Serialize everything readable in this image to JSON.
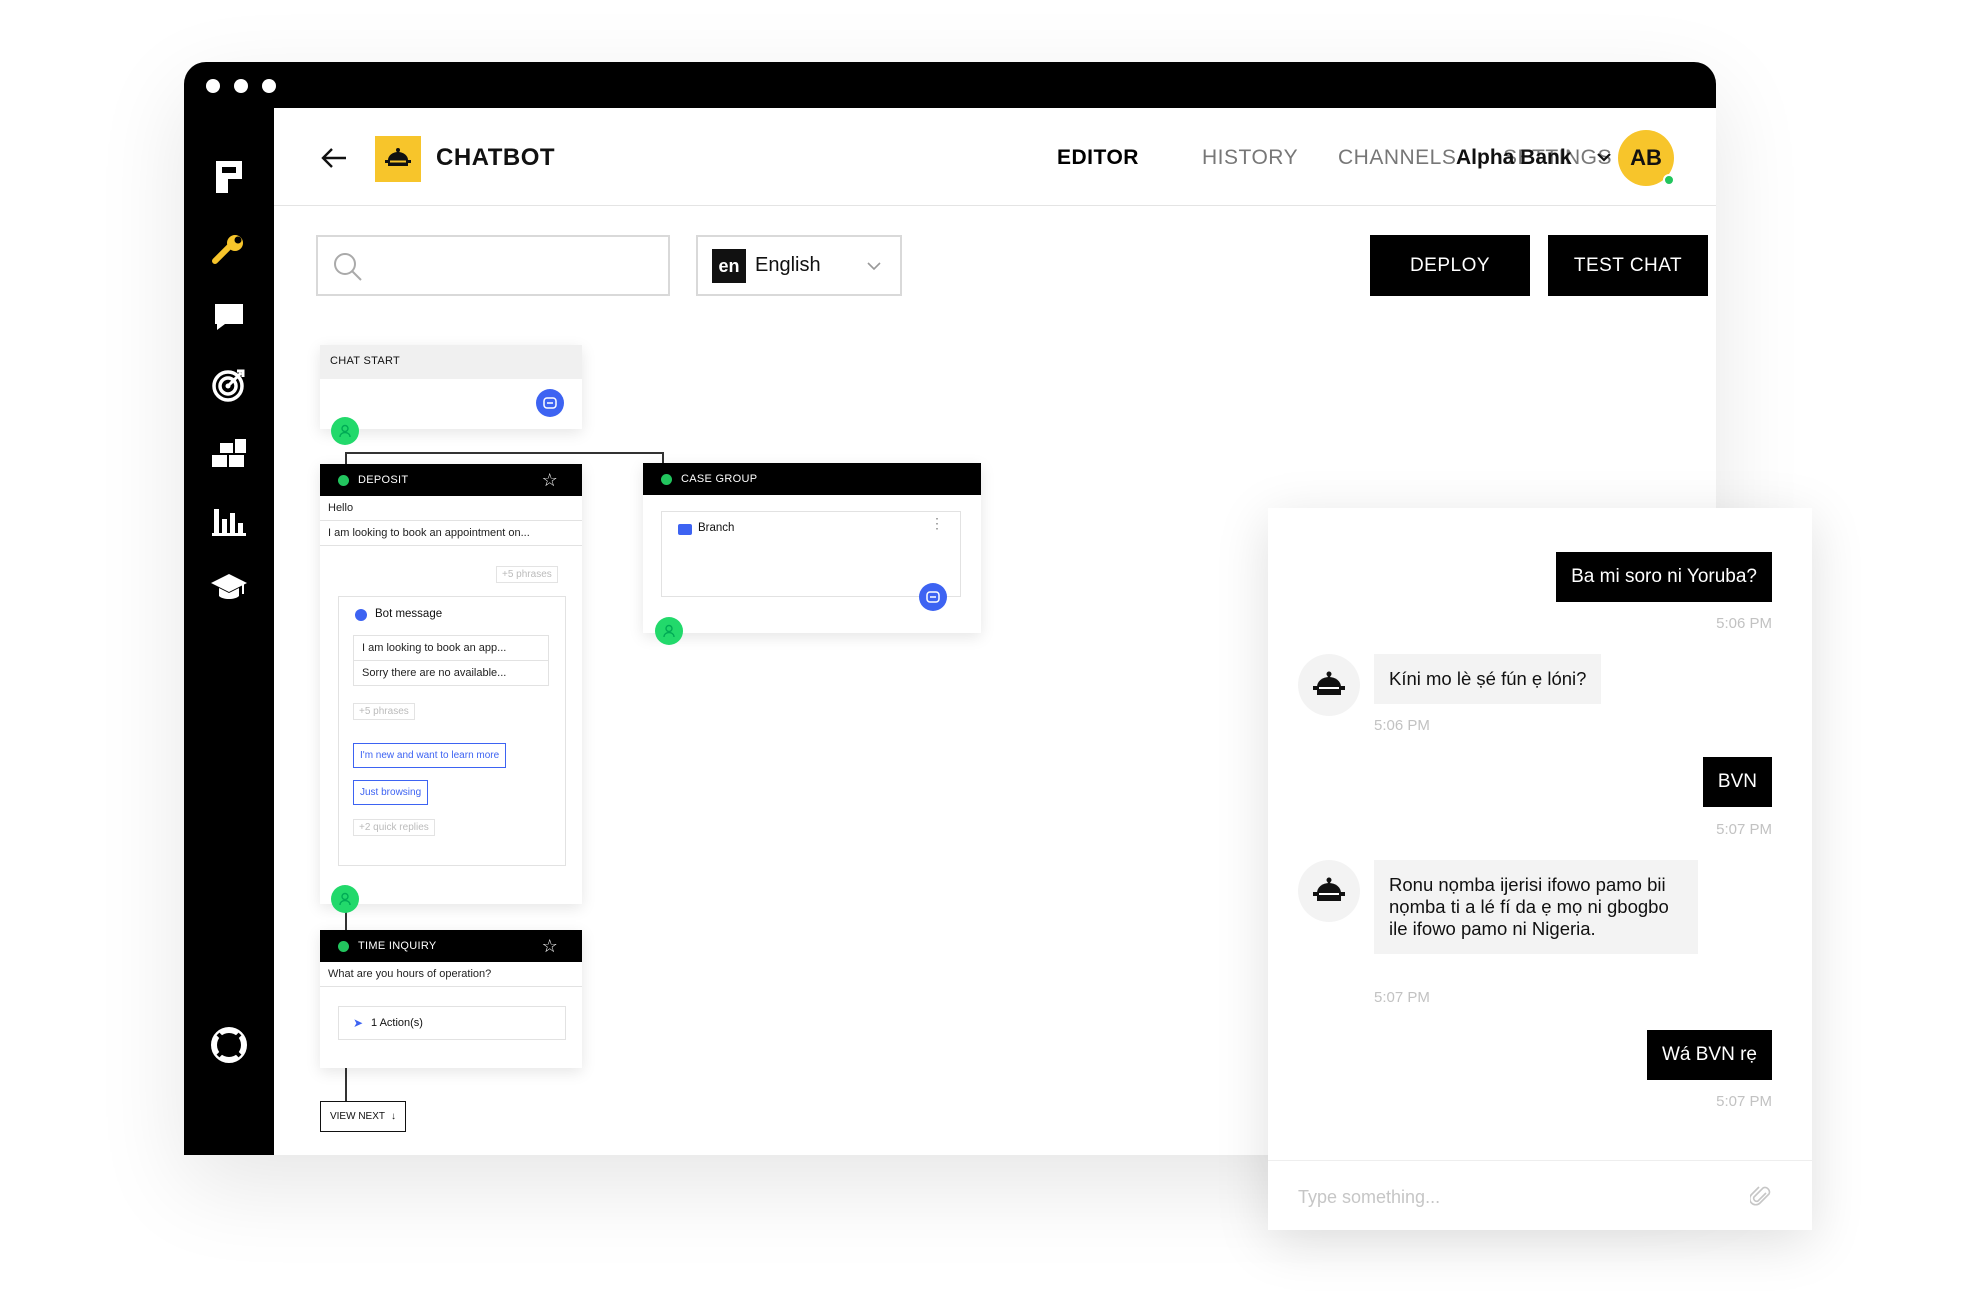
{
  "header": {
    "app_title": "CHATBOT",
    "tabs": [
      {
        "label": "EDITOR",
        "active": true
      },
      {
        "label": "HISTORY",
        "active": false
      },
      {
        "label": "CHANNELS",
        "active": false
      },
      {
        "label": "SETTINGS",
        "active": false
      }
    ],
    "organization": "Alpha Bank",
    "avatar_initials": "AB"
  },
  "toolbar": {
    "search_placeholder": "",
    "language_code": "en",
    "language_name": "English",
    "deploy_label": "DEPLOY",
    "test_chat_label": "TEST CHAT"
  },
  "sidebar": {
    "items": [
      "logo-icon",
      "wrench-icon",
      "chat-bubble-icon",
      "target-icon",
      "blocks-icon",
      "bar-chart-icon",
      "graduation-cap-icon",
      "lifebuoy-icon"
    ]
  },
  "flow": {
    "chat_start": {
      "title": "CHAT START"
    },
    "deposit": {
      "title": "DEPOSIT",
      "phrases": [
        "Hello",
        "I am looking to book an appointment on..."
      ],
      "more_phrases": "+5 phrases",
      "bot_message": {
        "title": "Bot message",
        "lines": [
          "I am looking to book an app...",
          "Sorry there are no available..."
        ],
        "more_phrases": "+5 phrases",
        "quick_replies": [
          "I'm new and want to learn more",
          "Just browsing"
        ],
        "more_quick_replies": "+2 quick replies"
      }
    },
    "case_group": {
      "title": "CASE GROUP",
      "item": "Branch"
    },
    "time_inquiry": {
      "title": "TIME INQUIRY",
      "phrase": "What are you hours of operation?",
      "actions": "1 Action(s)"
    },
    "view_next": "VIEW NEXT"
  },
  "chat": {
    "messages": [
      {
        "from": "user",
        "text": "Ba mi soro ni Yoruba?",
        "time": "5:06 PM"
      },
      {
        "from": "bot",
        "text": "Kíni mo lè ṣé fún ẹ lóni?",
        "time": "5:06 PM"
      },
      {
        "from": "user",
        "text": "BVN",
        "time": "5:07 PM"
      },
      {
        "from": "bot",
        "text": "Ronu nọmba ijerisi ifowo pamo bii nọmba ti a lé fí da ẹ mọ ni gbogbo ile ifowo pamo ni Nigeria.",
        "time": "5:07 PM"
      },
      {
        "from": "user",
        "text": "Wá BVN rẹ",
        "time": "5:07 PM"
      }
    ],
    "input_placeholder": "Type something..."
  },
  "colors": {
    "accent_yellow": "#f7c52b",
    "node_green": "#22d96b",
    "node_blue": "#3d63f2",
    "dark": "#000000"
  }
}
